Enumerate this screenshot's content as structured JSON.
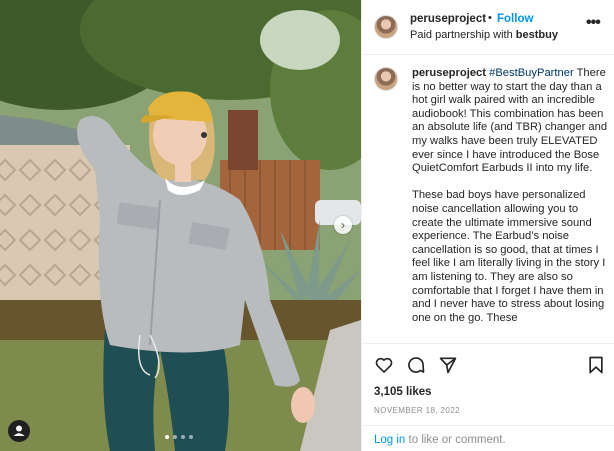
{
  "header": {
    "username": "peruseproject",
    "separator": "•",
    "follow_label": "Follow",
    "partner_prefix": "Paid partnership with",
    "partner_name": "bestbuy",
    "more_label": "•••"
  },
  "caption": {
    "username": "peruseproject",
    "hashtag": "#BestBuyPartner",
    "paragraph1": "There is no better way to start the day than a hot girl walk paired with an incredible audiobook! This combination has been an absolute life (and TBR) changer and my walks have been truly ELEVATED ever since I have introduced the Bose QuietComfort Earbuds II into my life.",
    "paragraph2": "These bad boys have personalized noise cancellation allowing you to create the ultimate immersive sound experience. The Earbud’s noise cancellation is so good, that at times I feel like I am literally living in the story I am listening to. They are also so comfortable that I forget I have them in and I never have to stress about losing one on the go. These"
  },
  "actions": {
    "icons": [
      "heart-icon",
      "comment-icon",
      "share-icon",
      "bookmark-icon"
    ],
    "likes": "3,105 likes",
    "date": "NOVEMBER 18, 2022",
    "login_link": "Log in",
    "login_rest": " to like or comment."
  },
  "media": {
    "next_symbol": "›",
    "carousel_count": 4,
    "carousel_active": 1
  },
  "colors": {
    "link_blue": "#0095f6",
    "hashtag_blue": "#00376b",
    "muted_gray": "#8e8e8e",
    "border": "#efefef"
  }
}
